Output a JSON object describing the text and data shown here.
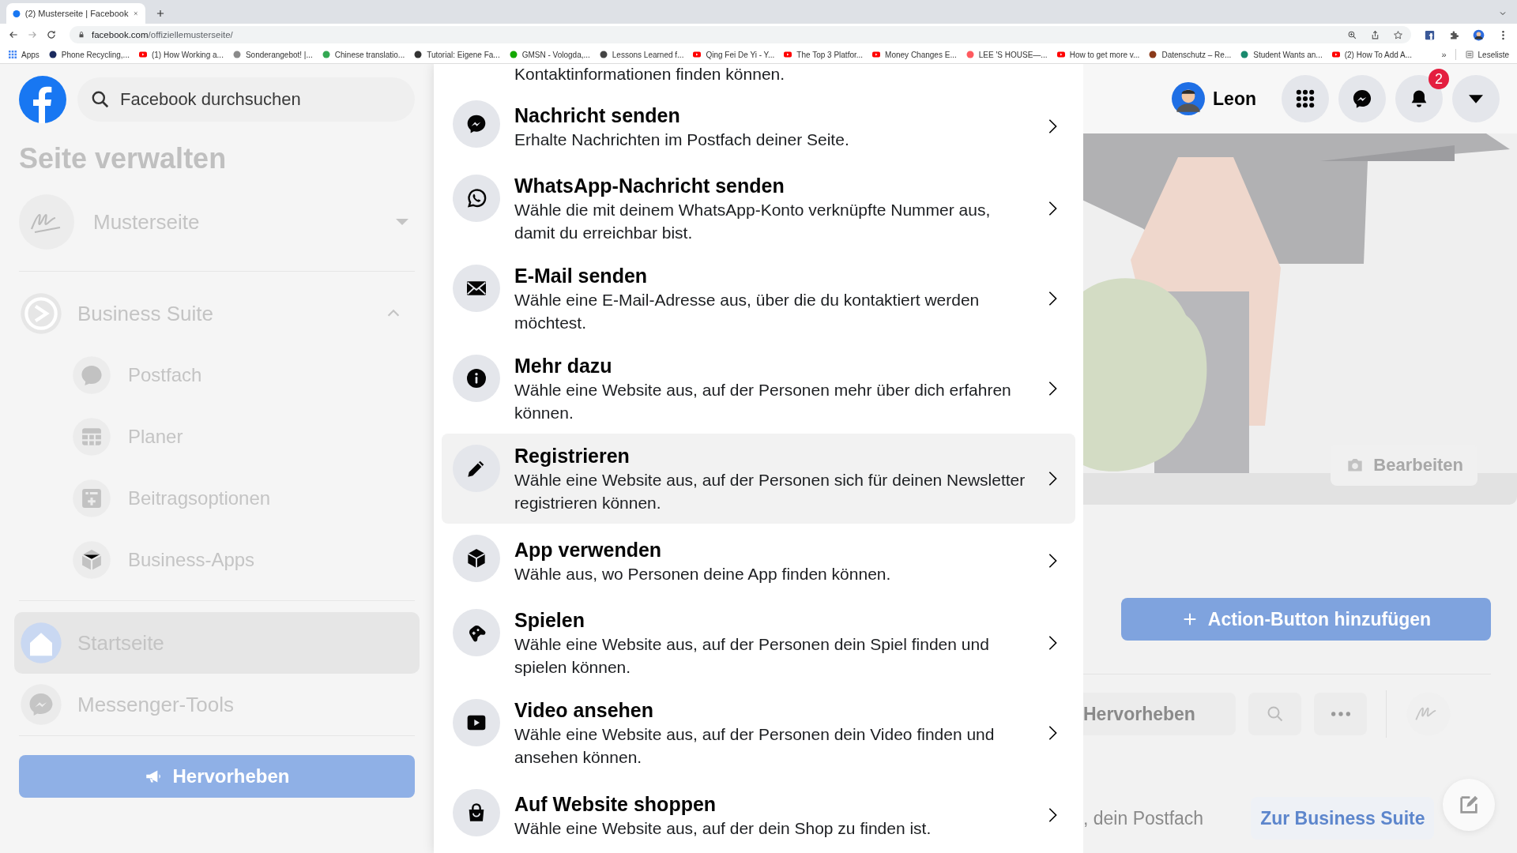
{
  "browser": {
    "tab": {
      "title": "(2) Musterseite | Facebook"
    },
    "url": {
      "host": "facebook.com",
      "path": "/offiziellemusterseite/"
    },
    "bookmarks": [
      {
        "label": "Apps",
        "kind": "grid",
        "color": "#4285f4"
      },
      {
        "label": "Phone Recycling,...",
        "kind": "dot",
        "color": "#1a2a5e"
      },
      {
        "label": "(1) How Working a...",
        "kind": "youtube",
        "color": "#ff0000"
      },
      {
        "label": "Sonderangebot! |...",
        "kind": "dot",
        "color": "#8a8a8a"
      },
      {
        "label": "Chinese translatio...",
        "kind": "dot",
        "color": "#34a853"
      },
      {
        "label": "Tutorial: Eigene Fa...",
        "kind": "dot",
        "color": "#333333"
      },
      {
        "label": "GMSN - Vologda,...",
        "kind": "dot",
        "color": "#14a800"
      },
      {
        "label": "Lessons Learned f...",
        "kind": "dot",
        "color": "#444444"
      },
      {
        "label": "Qing Fei De Yi - Y...",
        "kind": "youtube",
        "color": "#ff0000"
      },
      {
        "label": "The Top 3 Platfor...",
        "kind": "youtube",
        "color": "#ff0000"
      },
      {
        "label": "Money Changes E...",
        "kind": "youtube",
        "color": "#ff0000"
      },
      {
        "label": "LEE 'S HOUSE—...",
        "kind": "dot",
        "color": "#ff5a5f"
      },
      {
        "label": "How to get more v...",
        "kind": "youtube",
        "color": "#ff0000"
      },
      {
        "label": "Datenschutz – Re...",
        "kind": "dot",
        "color": "#8b3a1a"
      },
      {
        "label": "Student Wants an...",
        "kind": "dot",
        "color": "#1a8a6e"
      },
      {
        "label": "(2) How To Add A...",
        "kind": "youtube",
        "color": "#ff0000"
      }
    ],
    "bookmarks_more": "»",
    "reading_list": "Leseliste"
  },
  "header": {
    "search": {
      "placeholder": "Facebook durchsuchen"
    },
    "user": {
      "name": "Leon"
    },
    "notifications": {
      "badge": "2"
    }
  },
  "sidebar": {
    "title": "Seite verwalten",
    "page": {
      "name": "Musterseite"
    },
    "items": [
      {
        "label": "Business Suite",
        "selected": false,
        "expanded": true,
        "children": [
          {
            "label": "Postfach",
            "selected": false
          },
          {
            "label": "Planer",
            "selected": false
          },
          {
            "label": "Beitragsoptionen",
            "selected": false
          },
          {
            "label": "Business-Apps",
            "selected": false
          }
        ]
      },
      {
        "label": "Startseite",
        "selected": true
      },
      {
        "label": "Messenger-Tools",
        "selected": false
      }
    ],
    "promote_button": "Hervorheben"
  },
  "modal": {
    "intro_tail": "Kontaktinformationen finden können.",
    "options": [
      {
        "title": "Nachricht senden",
        "description": "Erhalte Nachrichten im Postfach deiner Seite.",
        "highlighted": false
      },
      {
        "title": "WhatsApp-Nachricht senden",
        "description": "Wähle die mit deinem WhatsApp-Konto verknüpfte Nummer aus, damit du erreichbar bist.",
        "highlighted": false
      },
      {
        "title": "E-Mail senden",
        "description": "Wähle eine E-Mail-Adresse aus, über die du kontaktiert werden möchtest.",
        "highlighted": false
      },
      {
        "title": "Mehr dazu",
        "description": "Wähle eine Website aus, auf der Personen mehr über dich erfahren können.",
        "highlighted": false
      },
      {
        "title": "Registrieren",
        "description": "Wähle eine Website aus, auf der Personen sich für deinen Newsletter registrieren können.",
        "highlighted": true
      },
      {
        "title": "App verwenden",
        "description": "Wähle aus, wo Personen deine App finden können.",
        "highlighted": false
      },
      {
        "title": "Spielen",
        "description": "Wähle eine Website aus, auf der Personen dein Spiel finden und spielen können.",
        "highlighted": false
      },
      {
        "title": "Video ansehen",
        "description": "Wähle eine Website aus, auf der Personen dein Video finden und ansehen können.",
        "highlighted": false
      },
      {
        "title": "Auf Website shoppen",
        "description": "Wähle eine Website aus, auf der dein Shop zu finden ist.",
        "highlighted": false
      }
    ]
  },
  "page": {
    "cover": {
      "kind": "picture",
      "edit_button": "Bearbeiten"
    },
    "action_button": "Action-Button hinzufügen",
    "toolbar": {
      "promote_button": "Hervorheben"
    },
    "inbox_text": ", dein Postfach",
    "business_suite_button": "Zur Business Suite"
  }
}
